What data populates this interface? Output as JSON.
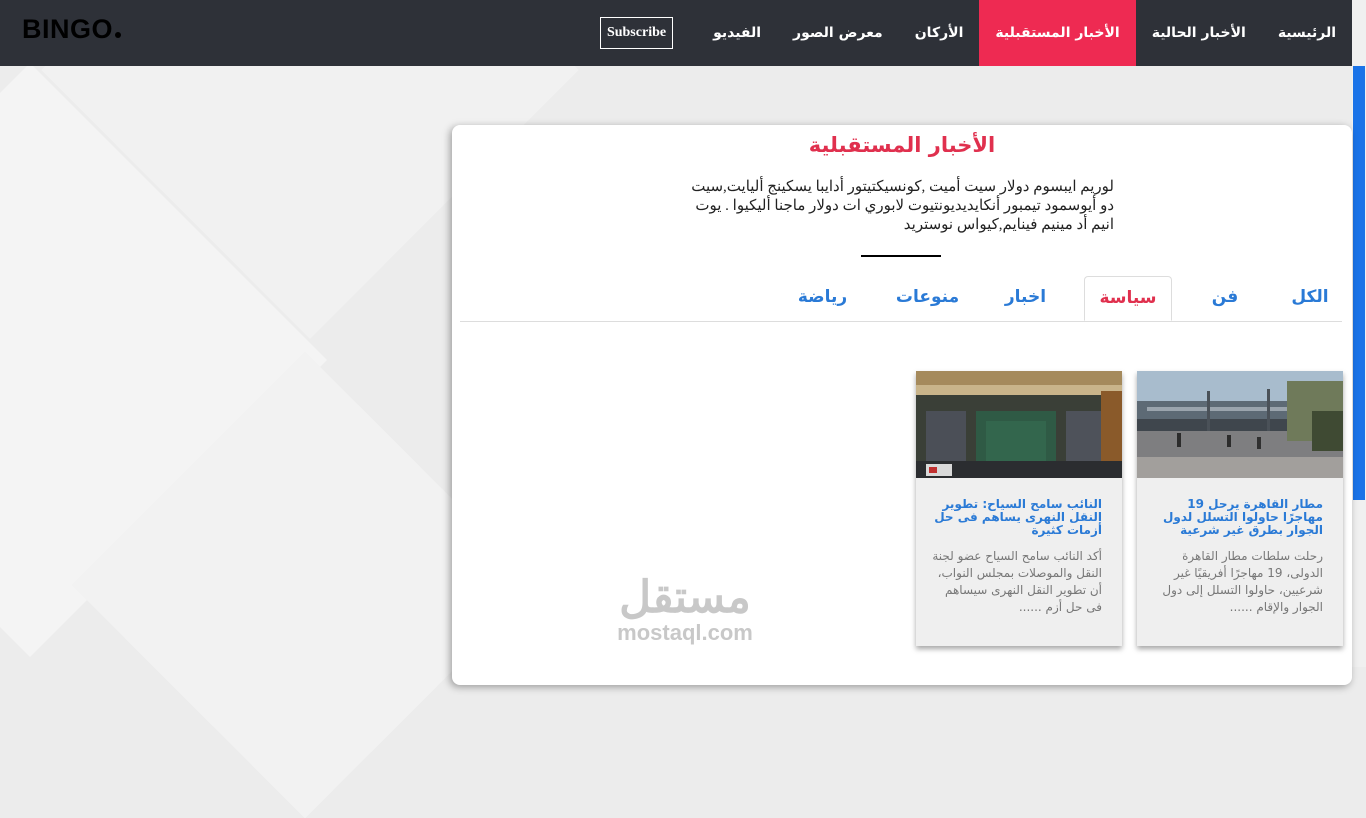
{
  "brand": {
    "logo": "BINGO"
  },
  "nav": {
    "items": [
      {
        "label": "الرئيسية",
        "active": false
      },
      {
        "label": "الأخبار الحالية",
        "active": false
      },
      {
        "label": "الأخبار المستقبلية",
        "active": true
      },
      {
        "label": "الأركان",
        "active": false
      },
      {
        "label": "معرض الصور",
        "active": false
      },
      {
        "label": "الفيديو",
        "active": false
      }
    ],
    "subscribe_label": "Subscribe"
  },
  "section": {
    "title": "الأخبار المستقبلية",
    "description": "لوريم ايبسوم دولار سيت أميت ,كونسيكتيتور أدايبا يسكينج أليايت,سيت دو أيوسمود تيمبور أنكايديديونتيوت لابوري ات دولار ماجنا أليكيوا . يوت انيم أد مينيم فينايم,كيواس نوستريد"
  },
  "tabs": [
    {
      "label": "الكل",
      "active": false
    },
    {
      "label": "فن",
      "active": false
    },
    {
      "label": "سياسة",
      "active": true
    },
    {
      "label": "اخبار",
      "active": false
    },
    {
      "label": "منوعات",
      "active": false
    },
    {
      "label": "رياضة",
      "active": false
    }
  ],
  "news": [
    {
      "title": "مطار القاهرة يرحل 19 مهاجرًا حاولوا التسلل لدول الجوار بطرق غير شرعية",
      "excerpt": "رحلت سلطات مطار القاهرة الدولى، 19 مهاجرًا أفريقيًا غير شرعيين، حاولوا التسلل إلى دول الجوار والإقام ......",
      "image": "airport-photo"
    },
    {
      "title": "النائب سامح السياح: تطوير النقل النهرى يساهم فى حل أزمات كثيرة",
      "excerpt": "أكد النائب سامح السياح عضو لجنة النقل والموصلات بمجلس النواب، أن تطوير النقل النهرى سيساهم فى حل أزم ......",
      "image": "parliament-photo"
    }
  ],
  "watermark": {
    "arabic": "مستقل",
    "latin": "mostaql.com"
  },
  "colors": {
    "accent": "#ee2a52",
    "link": "#2a7ad6",
    "navbar": "#2e3138"
  }
}
